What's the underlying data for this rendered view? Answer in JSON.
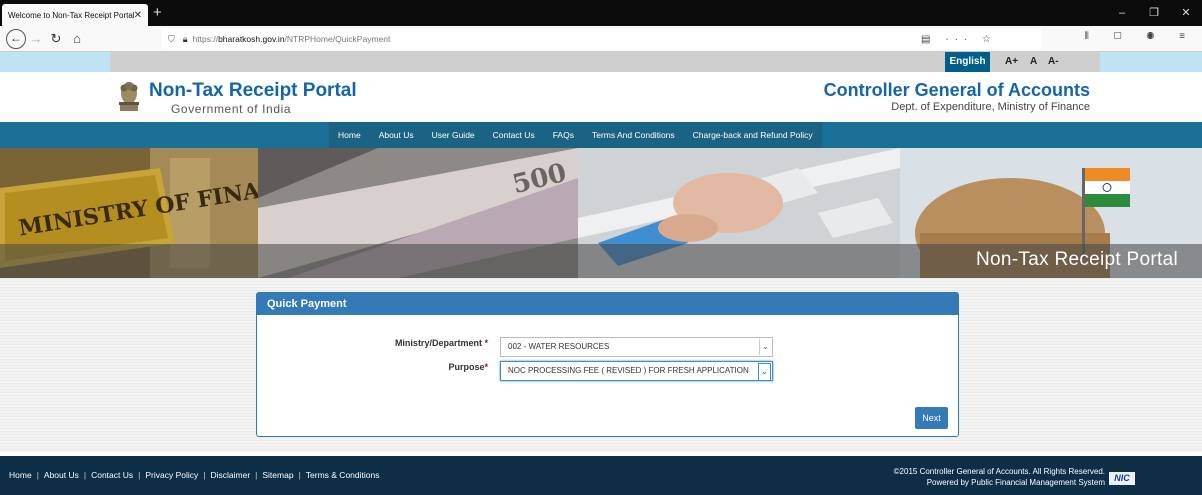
{
  "browser": {
    "tab_title": "Welcome to Non-Tax Receipt Portal",
    "tab_close": "✕",
    "new_tab": "+",
    "url_host": "bharatkosh.gov.in",
    "url_prefix": "https://",
    "url_path": "/NTRPHome/QuickPayment",
    "window_controls": [
      "–",
      "❐",
      "✕"
    ]
  },
  "lang": {
    "english": "English",
    "font_plus": "A+",
    "font_normal": "A",
    "font_minus": "A-"
  },
  "header": {
    "portal_title": "Non-Tax Receipt Portal",
    "portal_subtitle": "Government of India",
    "org_title": "Controller General of Accounts",
    "org_subtitle": "Dept. of Expenditure, Ministry of Finance"
  },
  "nav": {
    "items": [
      "Home",
      "About Us",
      "User Guide",
      "Contact Us",
      "FAQs",
      "Terms And Conditions",
      "Charge-back and Refund Policy"
    ]
  },
  "banner": {
    "caption": "Non-Tax Receipt Portal",
    "sign_text": "MINISTRY OF FINANCE",
    "note_value": "500"
  },
  "quick_payment": {
    "heading": "Quick Payment",
    "ministry_label": "Ministry/Department",
    "ministry_value": "002 - WATER RESOURCES",
    "purpose_label": "Purpose",
    "purpose_value": "NOC PROCESSING FEE ( REVISED ) FOR FRESH APPLICATION",
    "required_mark": "*",
    "next_label": "Next"
  },
  "footer": {
    "links": [
      "Home",
      "About Us",
      "Contact Us",
      "Privacy Policy",
      "Disclaimer",
      "Sitemap",
      "Terms & Conditions"
    ],
    "separator": "|",
    "copyright": "©2015 Controller General of Accounts. All Rights Reserved.",
    "powered": "Powered by  Public Financial Management System",
    "nic": "NIC"
  },
  "colors": {
    "brand_blue": "#1565a8",
    "nav_blue": "#1a6f97",
    "panel_blue": "#337ab7",
    "footer_navy": "#0e2d46"
  }
}
